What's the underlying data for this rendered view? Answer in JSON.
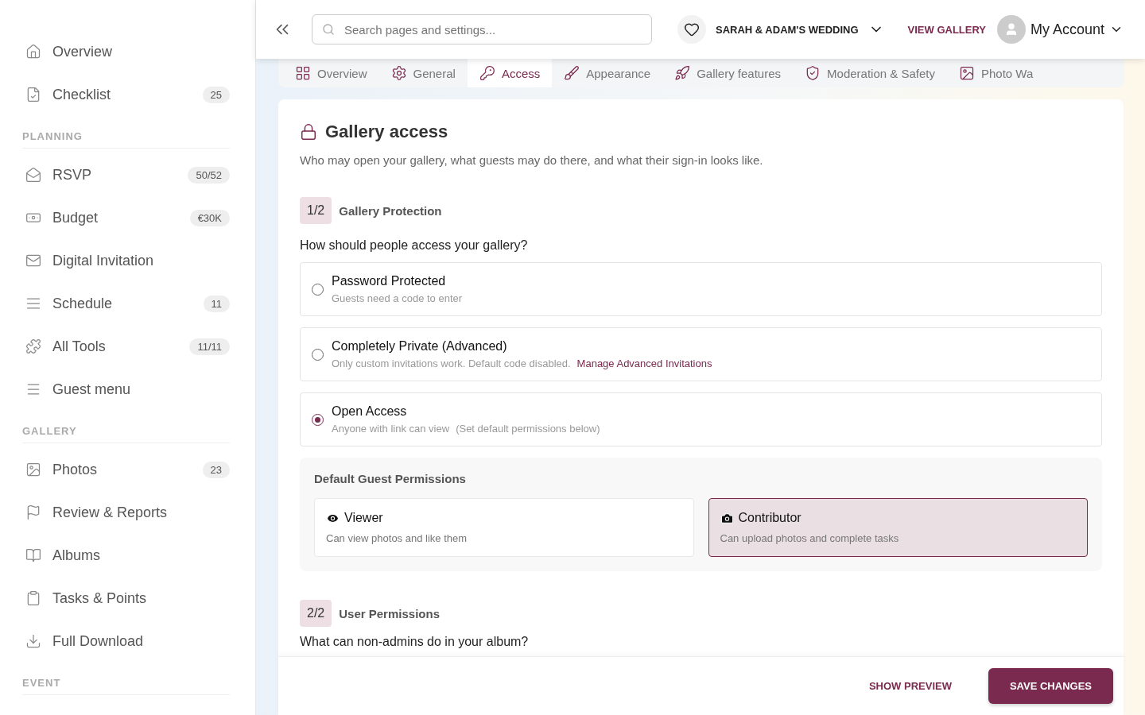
{
  "sidebar": {
    "groups": [
      {
        "items": [
          {
            "label": "Overview"
          },
          {
            "label": "Checklist",
            "badge": "25"
          }
        ]
      },
      {
        "title": "PLANNING",
        "items": [
          {
            "label": "RSVP",
            "badge": "50/52"
          },
          {
            "label": "Budget",
            "badge": "€30K"
          },
          {
            "label": "Digital Invitation"
          },
          {
            "label": "Schedule",
            "badge": "11"
          },
          {
            "label": "All Tools",
            "badge": "11/11"
          },
          {
            "label": "Guest menu"
          }
        ]
      },
      {
        "title": "GALLERY",
        "items": [
          {
            "label": "Photos",
            "badge": "23"
          },
          {
            "label": "Review & Reports"
          },
          {
            "label": "Albums"
          },
          {
            "label": "Tasks & Points"
          },
          {
            "label": "Full Download"
          }
        ]
      },
      {
        "title": "EVENT"
      }
    ]
  },
  "header": {
    "search": {
      "placeholder": "Search pages and settings..."
    },
    "event": "SARAH & ADAM'S WEDDING",
    "view_gallery": "VIEW GALLERY",
    "account": "My Account"
  },
  "tabs": [
    {
      "label": "Overview",
      "selected": false
    },
    {
      "label": "General",
      "selected": false
    },
    {
      "label": "Access",
      "selected": true
    },
    {
      "label": "Appearance",
      "selected": false
    },
    {
      "label": "Gallery features",
      "selected": false
    },
    {
      "label": "Moderation & Safety",
      "selected": false
    },
    {
      "label": "Photo Wa",
      "selected": false
    }
  ],
  "page": {
    "title": "Gallery access",
    "description": "Who may open your gallery, what guests may do there, and what their sign-in looks like.",
    "step1": {
      "number": "1/2",
      "title": "Gallery Protection"
    },
    "question": "How should people access your gallery?",
    "options": [
      {
        "title": "Password Protected",
        "description": "Guests need a code to enter",
        "selected": false
      },
      {
        "title": "Completely Private (Advanced)",
        "description": "Only custom invitations work. Default code disabled.",
        "link": "Manage Advanced Invitations",
        "selected": false
      },
      {
        "title": "Open Access",
        "description": "Anyone with link can view",
        "note": "(Set default permissions below)",
        "selected": true
      }
    ],
    "permissions": {
      "title": "Default Guest Permissions",
      "roles": [
        {
          "title": "Viewer",
          "description": "Can view photos and like them",
          "selected": false
        },
        {
          "title": "Contributor",
          "description": "Can upload photos and complete tasks",
          "selected": true
        }
      ]
    },
    "step2": {
      "number": "2/2",
      "title": "User Permissions"
    },
    "question2": "What can non-admins do in your album?"
  },
  "footer": {
    "preview": "SHOW PREVIEW",
    "save": "SAVE CHANGES"
  }
}
